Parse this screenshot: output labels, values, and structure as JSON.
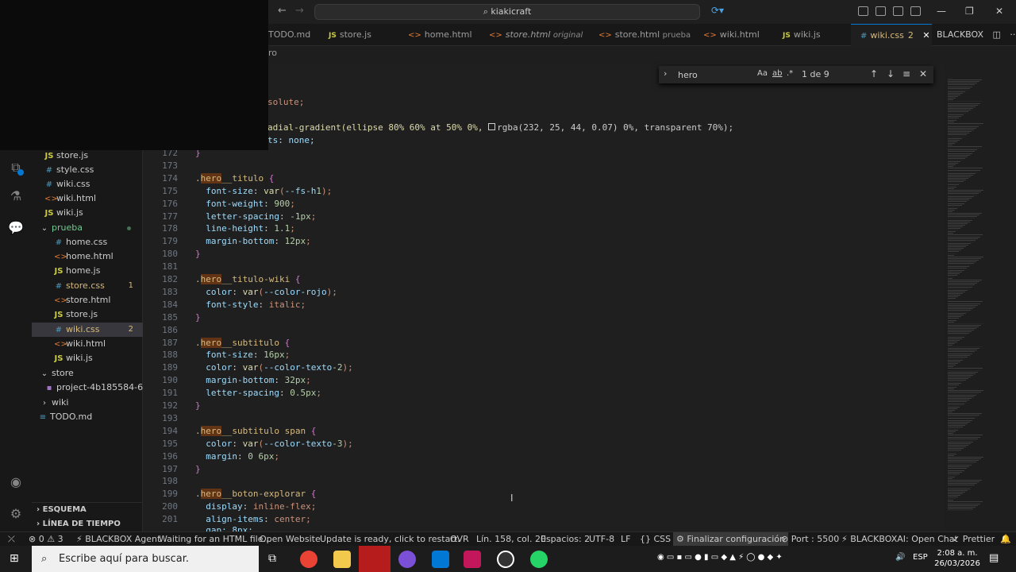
{
  "titlebar": {
    "search_text": "kiakicraft"
  },
  "tabs": [
    {
      "name": "TODO.md",
      "icon": "md",
      "desc": "",
      "badge": ""
    },
    {
      "name": "store.js",
      "icon": "JS",
      "desc": "",
      "badge": ""
    },
    {
      "name": "home.html",
      "icon": "<>",
      "desc": "",
      "badge": ""
    },
    {
      "name": "store.html",
      "icon": "<>",
      "desc": "original",
      "badge": ""
    },
    {
      "name": "store.html",
      "icon": "<>",
      "desc": "prueba",
      "badge": ""
    },
    {
      "name": "wiki.html",
      "icon": "<>",
      "desc": "",
      "badge": ""
    },
    {
      "name": "wiki.js",
      "icon": "JS",
      "desc": "",
      "badge": ""
    },
    {
      "name": "wiki.css",
      "icon": "#",
      "desc": "",
      "badge": "2"
    }
  ],
  "blackbox_label": "BLACKBOX",
  "breadcrumb": "ro",
  "find": {
    "query": "hero",
    "case_label": "Aa",
    "word_label": "ab",
    "regex_label": ".*",
    "count": "1 de 9"
  },
  "explorer": {
    "items": [
      {
        "label": "store.js",
        "icon": "JS",
        "badge": "",
        "dot": false
      },
      {
        "label": "style.css",
        "icon": "#",
        "badge": "",
        "dot": false
      },
      {
        "label": "wiki.css",
        "icon": "#",
        "badge": "",
        "dot": false
      },
      {
        "label": "wiki.html",
        "icon": "<>",
        "badge": "",
        "dot": false
      },
      {
        "label": "wiki.js",
        "icon": "JS",
        "badge": "",
        "dot": false
      },
      {
        "label": "prueba",
        "icon": "v",
        "badge": "",
        "dot": true
      },
      {
        "label": "home.css",
        "icon": "#",
        "badge": "",
        "dot": false
      },
      {
        "label": "home.html",
        "icon": "<>",
        "badge": "",
        "dot": false
      },
      {
        "label": "home.js",
        "icon": "JS",
        "badge": "",
        "dot": false
      },
      {
        "label": "store.css",
        "icon": "#",
        "badge": "1",
        "dot": false
      },
      {
        "label": "store.html",
        "icon": "<>",
        "badge": "",
        "dot": false
      },
      {
        "label": "store.js",
        "icon": "JS",
        "badge": "",
        "dot": false
      },
      {
        "label": "wiki.css",
        "icon": "#",
        "badge": "2",
        "dot": false
      },
      {
        "label": "wiki.html",
        "icon": "<>",
        "badge": "",
        "dot": false
      },
      {
        "label": "wiki.js",
        "icon": "JS",
        "badge": "",
        "dot": false
      },
      {
        "label": "store",
        "icon": "v",
        "badge": "",
        "dot": false
      },
      {
        "label": "project-4b185584-63...",
        "icon": "▪",
        "badge": "",
        "dot": false
      },
      {
        "label": "wiki",
        "icon": ">",
        "badge": "",
        "dot": false
      },
      {
        "label": "TODO.md",
        "icon": "≡",
        "badge": "",
        "dot": false
      }
    ],
    "outline_label": "ESQUEMA",
    "timeline_label": "LÍNEA DE TIEMPO"
  },
  "code": {
    "partial_top": [
      "solute;",
      "adial-gradient(ellipse 80% 60% at 50% 0%, ",
      "ts: none;"
    ],
    "gradient_tail": "rgba(232, 25, 44, 0.07) 0%, transparent 70%);",
    "lines": [
      {
        "n": "172",
        "t": "}"
      },
      {
        "n": "173",
        "t": ""
      },
      {
        "n": "174",
        "t": ".hero__titulo {"
      },
      {
        "n": "175",
        "t": "  font-size: var(--fs-h1);"
      },
      {
        "n": "176",
        "t": "  font-weight: 900;"
      },
      {
        "n": "177",
        "t": "  letter-spacing: -1px;"
      },
      {
        "n": "178",
        "t": "  line-height: 1.1;"
      },
      {
        "n": "179",
        "t": "  margin-bottom: 12px;"
      },
      {
        "n": "180",
        "t": "}"
      },
      {
        "n": "181",
        "t": ""
      },
      {
        "n": "182",
        "t": ".hero__titulo-wiki {"
      },
      {
        "n": "183",
        "t": "  color: var(--color-rojo);"
      },
      {
        "n": "184",
        "t": "  font-style: italic;"
      },
      {
        "n": "185",
        "t": "}"
      },
      {
        "n": "186",
        "t": ""
      },
      {
        "n": "187",
        "t": ".hero__subtitulo {"
      },
      {
        "n": "188",
        "t": "  font-size: 16px;"
      },
      {
        "n": "189",
        "t": "  color: var(--color-texto-2);"
      },
      {
        "n": "190",
        "t": "  margin-bottom: 32px;"
      },
      {
        "n": "191",
        "t": "  letter-spacing: 0.5px;"
      },
      {
        "n": "192",
        "t": "}"
      },
      {
        "n": "193",
        "t": ""
      },
      {
        "n": "194",
        "t": ".hero__subtitulo span {"
      },
      {
        "n": "195",
        "t": "  color: var(--color-texto-3);"
      },
      {
        "n": "196",
        "t": "  margin: 0 6px;"
      },
      {
        "n": "197",
        "t": "}"
      },
      {
        "n": "198",
        "t": ""
      },
      {
        "n": "199",
        "t": ".hero__boton-explorar {"
      },
      {
        "n": "200",
        "t": "  display: inline-flex;"
      },
      {
        "n": "201",
        "t": "  align-items: center;"
      }
    ],
    "partial_bottom": "  gap: 8px;"
  },
  "statusbar": {
    "errors": "0",
    "warnings": "3",
    "agent": "BLACKBOX Agent",
    "waiting": "Waiting for an HTML file...",
    "open_website": "Open Website",
    "update": "Update is ready, click to restart.",
    "ovr": "OVR",
    "position": "Lín. 158, col. 20",
    "spaces": "Espacios: 2",
    "encoding": "UTF-8",
    "eol": "LF",
    "language": "CSS",
    "finalize": "Finalizar configuración",
    "port": "Port : 5500",
    "blackbox_chat": "BLACKBOXAI: Open Chat",
    "prettier": "Prettier"
  },
  "taskbar": {
    "search_placeholder": "Escribe aquí para buscar.",
    "lang": "ESP",
    "time": "2:08 a. m.",
    "date": "26/03/2026"
  },
  "colors": {
    "accent": "#0078d4",
    "editor_bg": "#1f1f1f",
    "match_highlight": "#623315"
  }
}
